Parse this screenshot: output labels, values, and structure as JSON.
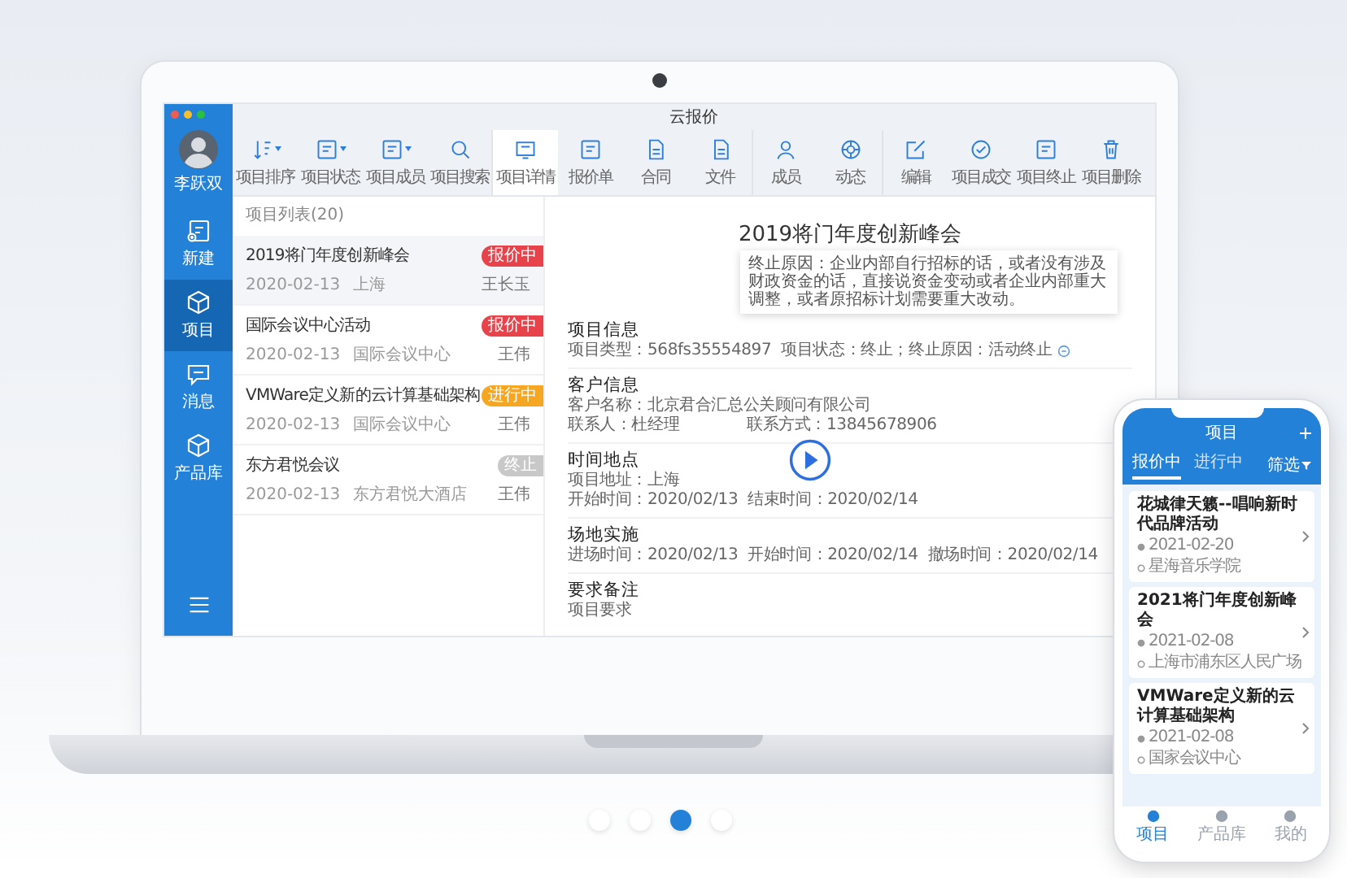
{
  "app": {
    "title": "云报价"
  },
  "sidebar": {
    "user_name": "李跃双",
    "items": [
      {
        "label": "新建",
        "selected": false
      },
      {
        "label": "项目",
        "selected": true
      },
      {
        "label": "消息",
        "selected": false
      },
      {
        "label": "产品库",
        "selected": false
      }
    ]
  },
  "toolbar": [
    {
      "label": "项目排序",
      "selected": false,
      "dropdown": true
    },
    {
      "label": "项目状态",
      "selected": false,
      "dropdown": true
    },
    {
      "label": "项目成员",
      "selected": false,
      "dropdown": true
    },
    {
      "label": "项目搜索",
      "selected": false,
      "dropdown": false
    },
    {
      "label": "项目详情",
      "selected": true,
      "dropdown": false
    },
    {
      "label": "报价单",
      "selected": false,
      "dropdown": false
    },
    {
      "label": "合同",
      "selected": false,
      "dropdown": false
    },
    {
      "label": "文件",
      "selected": false,
      "dropdown": false
    },
    {
      "label": "成员",
      "selected": false,
      "dropdown": false
    },
    {
      "label": "动态",
      "selected": false,
      "dropdown": false
    },
    {
      "label": "编辑",
      "selected": false,
      "dropdown": false
    },
    {
      "label": "项目成交",
      "selected": false,
      "dropdown": false
    },
    {
      "label": "项目终止",
      "selected": false,
      "dropdown": false
    },
    {
      "label": "项目删除",
      "selected": false,
      "dropdown": false
    }
  ],
  "project_list": {
    "header": "项目列表(20)",
    "rows": [
      {
        "title": "2019将门年度创新峰会",
        "date": "2020-02-13",
        "place": "上海",
        "person": "王长玉",
        "status": "报价中",
        "color": "#e8434b",
        "selected": true
      },
      {
        "title": "国际会议中心活动",
        "date": "2020-02-13",
        "place": "国际会议中心",
        "person": "王伟",
        "status": "报价中",
        "color": "#e8434b",
        "selected": false
      },
      {
        "title": "VMWare定义新的云计算基础架构",
        "date": "2020-02-13",
        "place": "国际会议中心",
        "person": "王伟",
        "status": "进行中",
        "color": "#f5a623",
        "selected": false
      },
      {
        "title": "东方君悦会议",
        "date": "2020-02-13",
        "place": "东方君悦大酒店",
        "person": "王伟",
        "status": "终止",
        "color": "#c8c8c8",
        "selected": false
      }
    ]
  },
  "detail": {
    "title": "2019将门年度创新峰会",
    "tooltip": "终止原因：企业内部自行招标的话，或者没有涉及财政资金的话，直接说资金变动或者企业内部重大调整，或者原招标计划需要重大改动。",
    "sections": [
      {
        "heading": "项目信息",
        "lines": [
          [
            {
              "text": "项目类型：568fs35554897",
              "kind": "plain"
            },
            {
              "text": "项目状态：终止；终止原因：活动终止",
              "kind": "with_info"
            }
          ]
        ]
      },
      {
        "heading": "客户信息",
        "lines": [
          [
            {
              "text": "客户名称：北京君合汇总公关顾问有限公司",
              "kind": "plain"
            }
          ],
          [
            {
              "text": "联系人：杜经理",
              "kind": "plain"
            },
            {
              "text": "联系方式：13845678906",
              "kind": "plain"
            }
          ]
        ]
      },
      {
        "heading": "时间地点",
        "lines": [
          [
            {
              "text": "项目地址：上海",
              "kind": "plain"
            }
          ],
          [
            {
              "text": "开始时间：2020/02/13",
              "kind": "plain"
            },
            {
              "text": "结束时间：2020/02/14",
              "kind": "plain"
            }
          ]
        ]
      },
      {
        "heading": "场地实施",
        "lines": [
          [
            {
              "text": "进场时间：2020/02/13",
              "kind": "plain"
            },
            {
              "text": "开始时间：2020/02/14",
              "kind": "plain"
            },
            {
              "text": "撤场时间：2020/02/14",
              "kind": "plain"
            }
          ]
        ]
      },
      {
        "heading": "要求备注",
        "lines": [
          [
            {
              "text": "项目要求",
              "kind": "plain"
            }
          ]
        ]
      }
    ]
  },
  "phone": {
    "title": "项目",
    "tabs": [
      {
        "label": "报价中",
        "selected": true
      },
      {
        "label": "进行中",
        "selected": false
      }
    ],
    "filter": "筛选",
    "cards": [
      {
        "title": "花城律天籁--唱响新时代品牌活动",
        "date": "2021-02-20",
        "place": "星海音乐学院"
      },
      {
        "title": "2021将门年度创新峰会",
        "date": "2021-02-08",
        "place": "上海市浦东区人民广场"
      },
      {
        "title": "VMWare定义新的云计算基础架构",
        "date": "2021-02-08",
        "place": "国家会议中心"
      }
    ],
    "tabbar": [
      {
        "label": "项目",
        "selected": true
      },
      {
        "label": "产品库",
        "selected": false
      },
      {
        "label": "我的",
        "selected": false
      }
    ]
  },
  "carousel": [
    {
      "selected": false
    },
    {
      "selected": false
    },
    {
      "selected": true
    },
    {
      "selected": false
    }
  ]
}
